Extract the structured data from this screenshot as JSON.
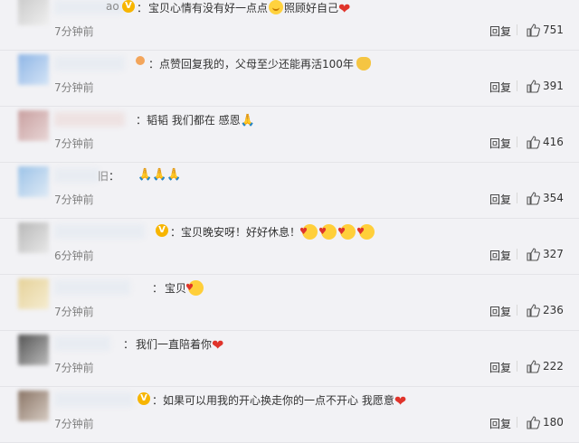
{
  "comments": [
    {
      "suffix": "ao",
      "text": "宝贝心情有没有好一点点",
      "text2": "照顾好自己",
      "time": "7分钟前",
      "reply": "回复",
      "likes": "751",
      "badge": "V"
    },
    {
      "suffix": "",
      "text": "点赞回复我的，父母至少还能再活100年",
      "time": "7分钟前",
      "reply": "回复",
      "likes": "391"
    },
    {
      "suffix": "",
      "text": "韬韬 我们都在 感恩",
      "time": "7分钟前",
      "reply": "回复",
      "likes": "416"
    },
    {
      "suffix": "旧",
      "text": "",
      "time": "7分钟前",
      "reply": "回复",
      "likes": "354"
    },
    {
      "suffix": "",
      "text": "宝贝晚安呀！好好休息！",
      "time": "6分钟前",
      "reply": "回复",
      "likes": "327",
      "badge": "V"
    },
    {
      "suffix": "",
      "text": "宝贝",
      "time": "7分钟前",
      "reply": "回复",
      "likes": "236"
    },
    {
      "suffix": "",
      "text": "我们一直陪着你",
      "time": "7分钟前",
      "reply": "回复",
      "likes": "222"
    },
    {
      "suffix": "",
      "text": "如果可以用我的开心换走你的一点不开心 我愿意",
      "time": "7分钟前",
      "reply": "回复",
      "likes": "180",
      "badge": "V"
    }
  ],
  "icons": {
    "like": "thumbs-up-icon",
    "heart": "heart-emoji",
    "pray": "pray-emoji"
  },
  "colors": {
    "background": "#f2f2f5",
    "badge": "#f7b500",
    "time": "#808080",
    "heart": "#e0342b"
  }
}
